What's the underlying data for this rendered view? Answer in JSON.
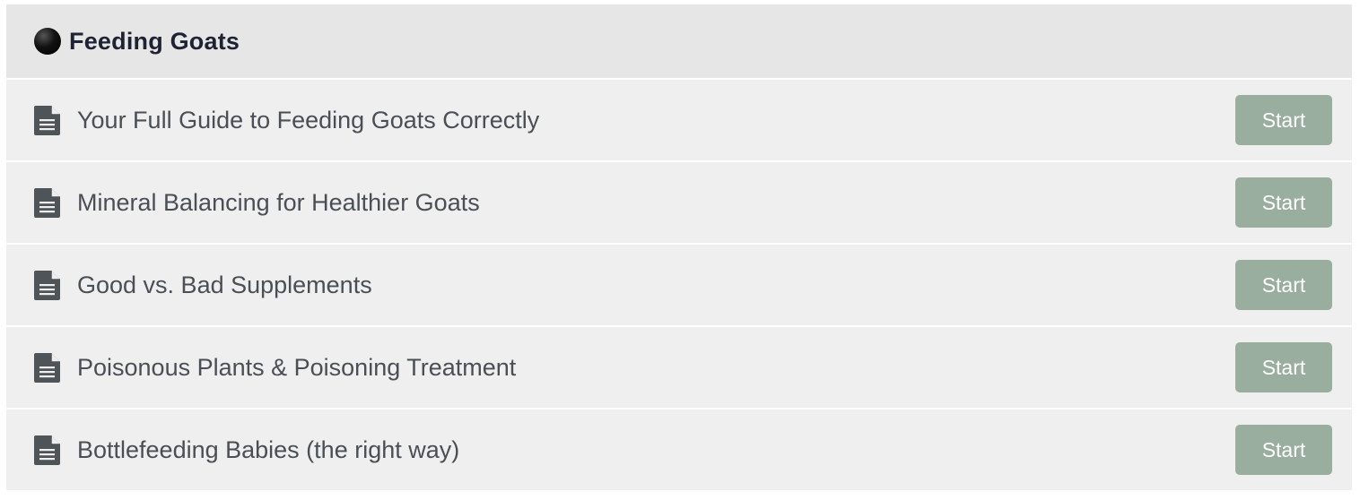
{
  "section": {
    "title": "Feeding Goats",
    "status_icon": "black-circle-icon"
  },
  "lessons": [
    {
      "title": "Your Full Guide to Feeding Goats Correctly",
      "icon": "document-icon",
      "button_label": "Start"
    },
    {
      "title": "Mineral Balancing for Healthier Goats",
      "icon": "document-icon",
      "button_label": "Start"
    },
    {
      "title": "Good vs. Bad Supplements",
      "icon": "document-icon",
      "button_label": "Start"
    },
    {
      "title": "Poisonous Plants & Poisoning Treatment",
      "icon": "document-icon",
      "button_label": "Start"
    },
    {
      "title": "Bottlefeeding Babies (the right way)",
      "icon": "document-icon",
      "button_label": "Start"
    }
  ],
  "colors": {
    "header_background": "#e6e6e6",
    "row_background": "#efefef",
    "button_background": "#9aae9f",
    "icon_color": "#4e5457"
  }
}
